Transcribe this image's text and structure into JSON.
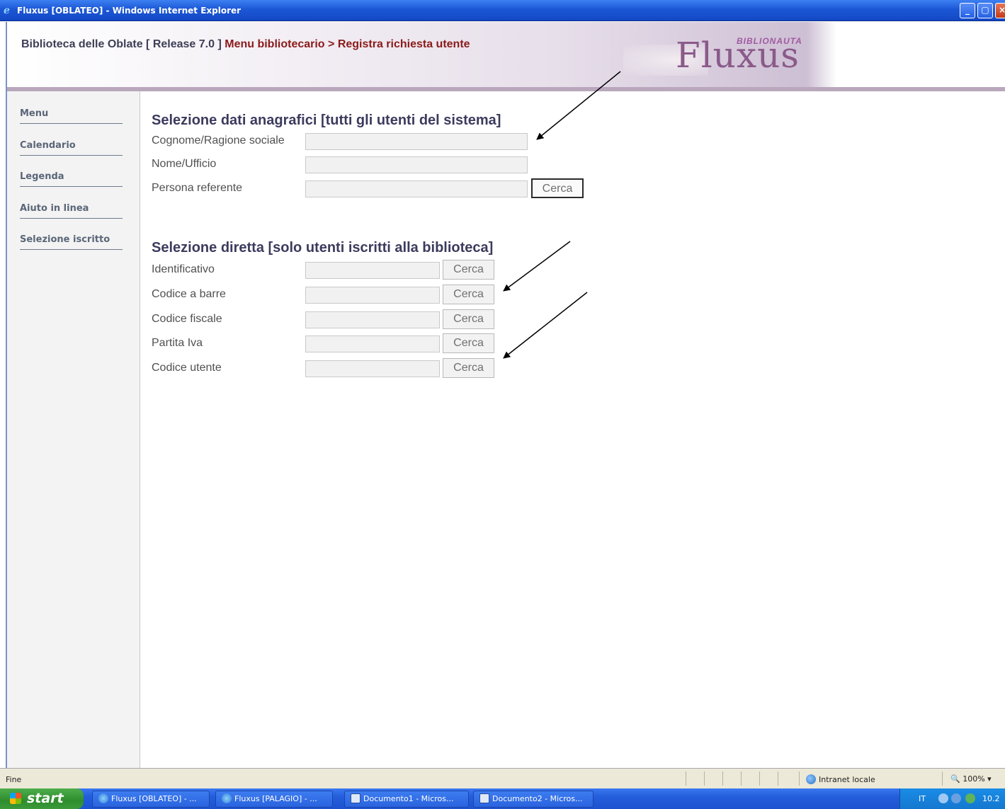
{
  "window": {
    "title": "Fluxus [OBLATEO] - Windows Internet Explorer",
    "min_label": "_",
    "max_label": "▢",
    "close_label": "×"
  },
  "header": {
    "library": "Biblioteca delle Oblate [ Release 7.0 ]",
    "menu_path": "Menu bibliotecario > Registra richiesta utente",
    "logo_text": "Fluxus",
    "logo_tag": "BIBLIONAUTA"
  },
  "sidebar": {
    "items": [
      {
        "label": "Menu"
      },
      {
        "label": "Calendario"
      },
      {
        "label": "Legenda"
      },
      {
        "label": "Aiuto in linea"
      },
      {
        "label": "Selezione iscritto"
      }
    ]
  },
  "anagrafica": {
    "title": "Selezione dati anagrafici [tutti gli utenti del sistema]",
    "fields": [
      {
        "label": "Cognome/Ragione sociale",
        "value": ""
      },
      {
        "label": "Nome/Ufficio",
        "value": ""
      },
      {
        "label": "Persona referente",
        "value": ""
      }
    ],
    "search_label": "Cerca"
  },
  "diretta": {
    "title": "Selezione diretta [solo utenti iscritti alla biblioteca]",
    "fields": [
      {
        "label": "Identificativo",
        "value": "",
        "button": "Cerca"
      },
      {
        "label": "Codice a barre",
        "value": "",
        "button": "Cerca"
      },
      {
        "label": "Codice fiscale",
        "value": "",
        "button": "Cerca"
      },
      {
        "label": "Partita Iva",
        "value": "",
        "button": "Cerca"
      },
      {
        "label": "Codice utente",
        "value": "",
        "button": "Cerca"
      }
    ]
  },
  "statusbar": {
    "status": "Fine",
    "zone": "Intranet locale",
    "zoom": "100%"
  },
  "taskbar": {
    "start": "start",
    "buttons": [
      {
        "label": "Fluxus [OBLATEO] - ...",
        "icon": "ie-icon"
      },
      {
        "label": "Fluxus [PALAGIO] - ...",
        "icon": "ie-icon"
      },
      {
        "label": "Documento1 - Micros...",
        "icon": "word-icon"
      },
      {
        "label": "Documento2 - Micros...",
        "icon": "word-icon"
      }
    ],
    "lang": "IT",
    "clock": "10.2"
  }
}
